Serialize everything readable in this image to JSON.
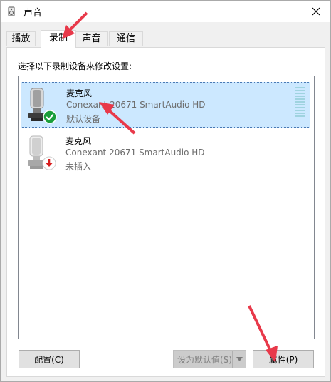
{
  "window": {
    "title": "声音",
    "close_icon": "close-icon"
  },
  "tabs": [
    {
      "label": "播放",
      "active": false
    },
    {
      "label": "录制",
      "active": true
    },
    {
      "label": "声音",
      "active": false
    },
    {
      "label": "通信",
      "active": false
    }
  ],
  "instruction": "选择以下录制设备来修改设置:",
  "devices": [
    {
      "name": "麦克风",
      "driver": "Conexant 20671 SmartAudio HD",
      "status": "默认设备",
      "selected": true,
      "badge_icon": "check-badge-icon",
      "badge_color": "#1a9e3a"
    },
    {
      "name": "麦克风",
      "driver": "Conexant 20671 SmartAudio HD",
      "status": "未插入",
      "selected": false,
      "badge_icon": "unplugged-badge-icon",
      "badge_color": "#d81e1e"
    }
  ],
  "buttons": {
    "configure": "配置(C)",
    "set_default": "设为默认值(S)",
    "properties": "属性(P)"
  },
  "colors": {
    "selection": "#cce8ff",
    "annotation_arrow": "#e8394a"
  }
}
